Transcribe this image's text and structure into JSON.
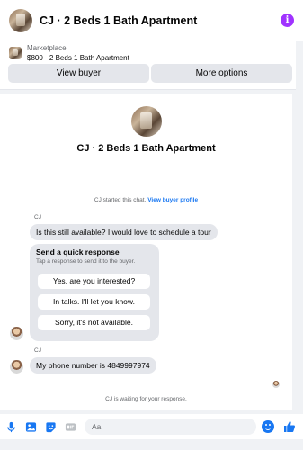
{
  "header": {
    "title": "CJ · 2 Beds 1 Bath Apartment",
    "info_icon": "info-icon",
    "info_glyph": "i",
    "accent": "#a033ff"
  },
  "listing": {
    "label": "Marketplace",
    "summary": "$800 · 2 Beds 1 Bath Apartment",
    "view_buyer": "View buyer",
    "more_options": "More options"
  },
  "chat": {
    "intro_title": "CJ · 2 Beds 1 Bath Apartment",
    "started_text": "CJ started this chat.",
    "view_profile_link": "View buyer profile",
    "messages": [
      {
        "sender": "CJ",
        "text": "Is this still available? I would love to schedule a tour"
      },
      {
        "sender": "CJ",
        "text": "My phone number is 4849997974"
      }
    ],
    "quick_response": {
      "title": "Send a quick response",
      "subtitle": "Tap a response to send it to the buyer.",
      "options": [
        "Yes, are you interested?",
        "In talks. I'll let you know.",
        "Sorry, it's not available."
      ]
    },
    "waiting_text": "CJ is waiting for your response."
  },
  "composer": {
    "placeholder": "Aa",
    "icons": [
      "microphone-icon",
      "image-icon",
      "sticker-icon",
      "gif-icon",
      "emoji-icon",
      "like-icon"
    ],
    "accent": "#1877f2"
  }
}
